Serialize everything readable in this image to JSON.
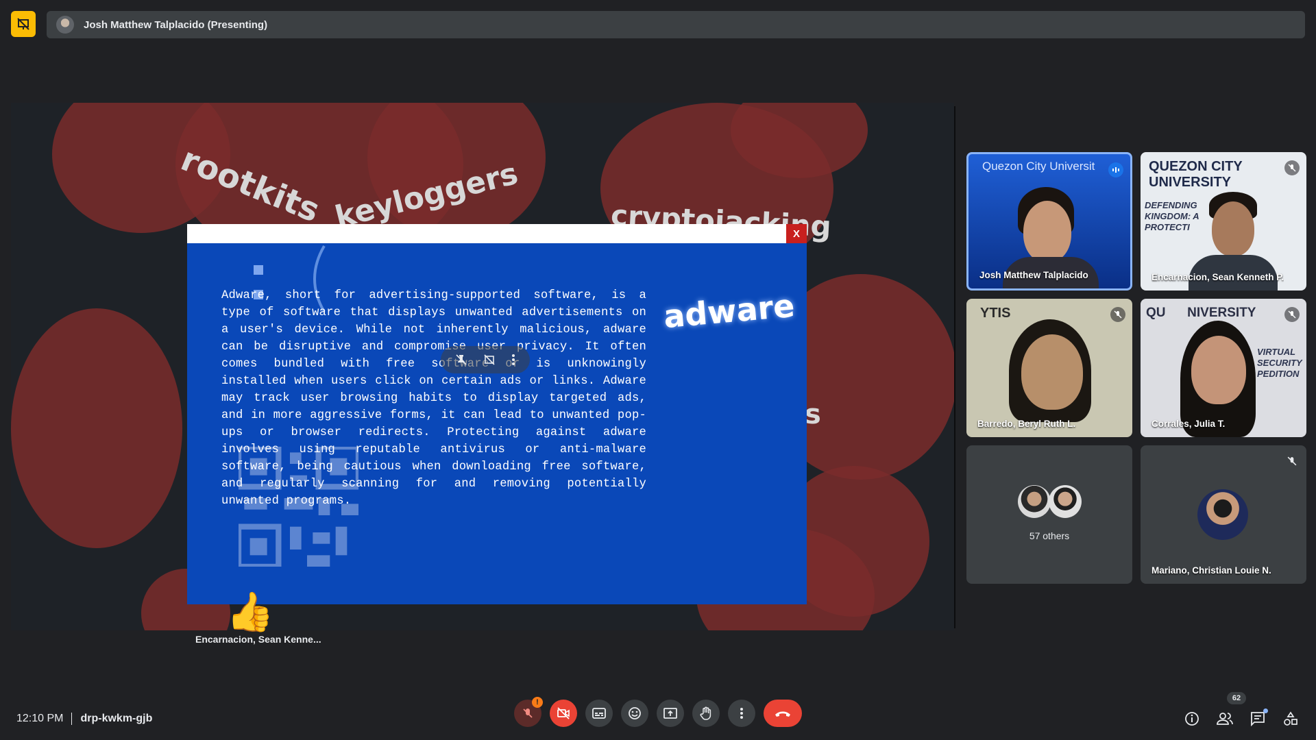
{
  "header": {
    "presenting_label": "Josh Matthew Talplacido (Presenting)"
  },
  "slide": {
    "words": [
      "rootkits",
      "keyloggers",
      "cryptojacking",
      "s"
    ],
    "popup_close": "X",
    "popup_heading": "adware",
    "popup_text": "Adware, short for advertising-supported software, is a type of software that displays unwanted advertisements on a user's device. While not inherently malicious, adware can be disruptive and compromise user privacy. It often comes bundled with free software or is unknowingly installed when users click on certain ads or links. Adware may track user browsing habits to display targeted ads, and in more aggressive forms, it can lead to unwanted pop-ups or browser redirects. Protecting against adware involves using reputable antivirus or anti-malware software, being cautious when downloading free software, and regularly scanning for and removing potentially unwanted programs."
  },
  "reaction": {
    "emoji": "👍",
    "name": "Encarnacion, Sean Kenne..."
  },
  "participants": [
    {
      "name": "Josh Matthew Talplacido",
      "banner": "Quezon City Universit",
      "speaking": true
    },
    {
      "name": "Encarnacion, Sean Kenneth P.",
      "banner": "QUEZON CITY UNIVERSITY",
      "muted": true
    },
    {
      "name": "Barredo, Beryl Ruth L.",
      "banner": "YTIS",
      "muted": true
    },
    {
      "name": "Corrales, Julia T.",
      "banner": "QU      NIVERSITY",
      "muted": true
    },
    {
      "name": "57 others"
    },
    {
      "name": "Mariano, Christian Louie N.",
      "muted": true
    }
  ],
  "footer": {
    "time": "12:10 PM",
    "meeting_code": "drp-kwkm-gjb",
    "people_count": "62",
    "mic_alert": "!"
  },
  "colors": {
    "accent_yellow": "#fbbc04",
    "end_call_red": "#ea4335",
    "popup_blue": "#0a48b8",
    "speaking_border": "#8ab4f8"
  }
}
